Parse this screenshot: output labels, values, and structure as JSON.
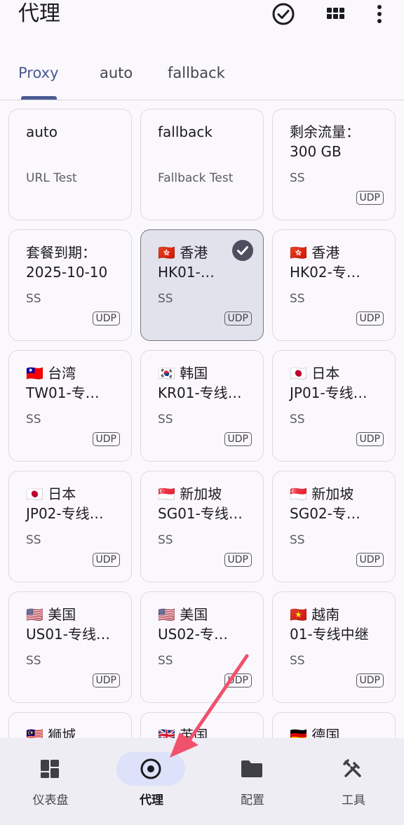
{
  "appbar": {
    "title": "代理",
    "icons": [
      "check-circle-icon",
      "grid-icon",
      "more-vert-icon"
    ]
  },
  "tabs": [
    {
      "label": "Proxy",
      "active": true
    },
    {
      "label": "auto",
      "active": false
    },
    {
      "label": "fallback",
      "active": false
    }
  ],
  "proxies": [
    {
      "name": "auto",
      "type": "URL Test",
      "udp": false,
      "selected": false
    },
    {
      "name": "fallback",
      "type": "Fallback Test",
      "udp": false,
      "selected": false
    },
    {
      "name": "剩余流量：\n300 GB",
      "type": "SS",
      "udp": true,
      "selected": false
    },
    {
      "name": "套餐到期：\n2025-10-10",
      "type": "SS",
      "udp": true,
      "selected": false
    },
    {
      "name": "🇭🇰 香港\nHK01-…",
      "type": "SS",
      "udp": true,
      "selected": true
    },
    {
      "name": "🇭🇰 香港\nHK02-专…",
      "type": "SS",
      "udp": true,
      "selected": false
    },
    {
      "name": "🇹🇼 台湾\nTW01-专…",
      "type": "SS",
      "udp": true,
      "selected": false
    },
    {
      "name": "🇰🇷 韩国\nKR01-专线…",
      "type": "SS",
      "udp": true,
      "selected": false
    },
    {
      "name": "🇯🇵 日本\nJP01-专线…",
      "type": "SS",
      "udp": true,
      "selected": false
    },
    {
      "name": "🇯🇵 日本\nJP02-专线…",
      "type": "SS",
      "udp": true,
      "selected": false
    },
    {
      "name": "🇸🇬 新加坡\nSG01-专线…",
      "type": "SS",
      "udp": true,
      "selected": false
    },
    {
      "name": "🇸🇬 新加坡\nSG02-专…",
      "type": "SS",
      "udp": true,
      "selected": false
    },
    {
      "name": "🇺🇸 美国\nUS01-专线…",
      "type": "SS",
      "udp": true,
      "selected": false
    },
    {
      "name": "🇺🇸 美国\nUS02-专…",
      "type": "SS",
      "udp": true,
      "selected": false
    },
    {
      "name": "🇻🇳 越南\n01-专线中继",
      "type": "SS",
      "udp": true,
      "selected": false
    },
    {
      "name": "🇲🇾 狮城",
      "type": "",
      "udp": false,
      "selected": false
    },
    {
      "name": "🇬🇧 英国",
      "type": "",
      "udp": false,
      "selected": false
    },
    {
      "name": "🇩🇪 德国",
      "type": "",
      "udp": false,
      "selected": false
    }
  ],
  "udp_label": "UDP",
  "bottom_nav": [
    {
      "label": "仪表盘",
      "icon": "dashboard-icon",
      "active": false
    },
    {
      "label": "代理",
      "icon": "radio-button-icon",
      "active": true
    },
    {
      "label": "配置",
      "icon": "folder-icon",
      "active": false
    },
    {
      "label": "工具",
      "icon": "tools-icon",
      "active": false
    }
  ],
  "colors": {
    "accent": "#4a5b93",
    "selected_card": "#e1e2ec",
    "annotation_arrow": "#f0516c"
  }
}
